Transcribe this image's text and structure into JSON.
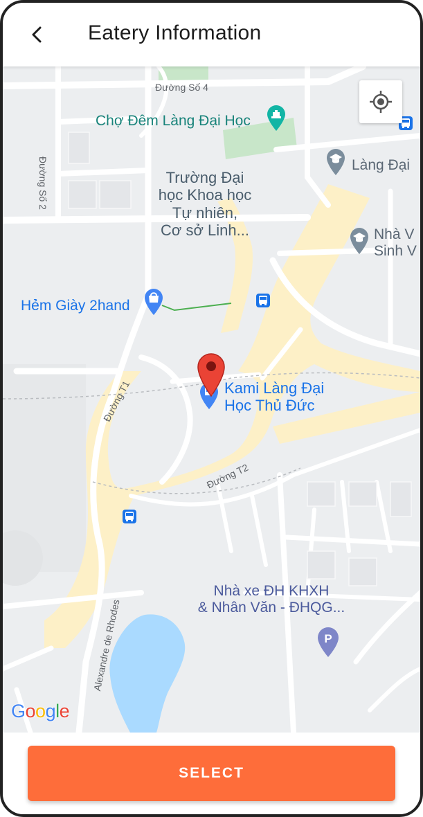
{
  "header": {
    "title": "Eatery Information",
    "back_icon": "chevron-left-icon"
  },
  "map": {
    "streets": {
      "duong_so_4": "Đường Số 4",
      "duong_so_2": "Đường Số 2",
      "duong_t1": "Đường T1",
      "duong_t2": "Đường T2",
      "alexandre": "Alexandre de Rhodes"
    },
    "pois": {
      "market": "Chợ Đêm Làng Đại Học",
      "university_line1": "Trường Đại",
      "university_line2": "học Khoa học",
      "university_line3": "Tự nhiên,",
      "university_line4": "Cơ sở Linh...",
      "lang_dai": "Làng Đại",
      "nha_v_line1": "Nhà V",
      "nha_v_line2": "Sinh V",
      "shoe_shop": "Hẻm Giày 2hand",
      "kami_line1": "Kami Làng Đại",
      "kami_line2": "Học Thủ Đức",
      "parking_line1": "Nhà xe ĐH KHXH",
      "parking_line2": "& Nhân Văn -  ĐHQG..."
    },
    "attribution": [
      "G",
      "o",
      "o",
      "g",
      "l",
      "e"
    ],
    "colors": {
      "accent": "#fe6d3a",
      "pin": "#d93025",
      "water": "#aadaff",
      "park": "#c8e6c9",
      "major_road": "#fdf0c7"
    },
    "icons": {
      "locate": "my-location-icon",
      "pin": "map-pin-icon",
      "bus": "bus-stop-icon",
      "school": "school-icon",
      "shop": "shopping-bag-icon",
      "parking": "parking-icon",
      "restaurant": "restaurant-icon",
      "landmark": "landmark-icon"
    }
  },
  "actions": {
    "select_label": "SELECT"
  }
}
